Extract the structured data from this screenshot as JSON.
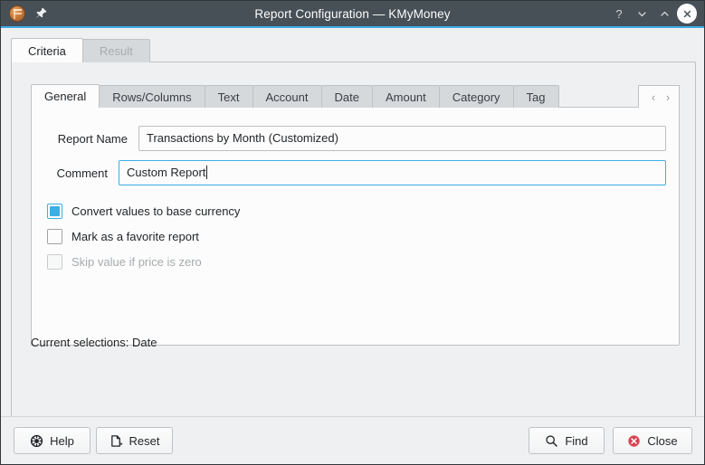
{
  "window": {
    "title": "Report Configuration — KMyMoney",
    "app_icon": "kmymoney-coin-icon",
    "pin_icon": "pin-icon",
    "controls": {
      "help": "?",
      "minimize": "minimize-icon",
      "maximize": "maximize-icon",
      "close": "close-icon"
    },
    "accent_color": "#3daee9",
    "titlebar_color": "#475057"
  },
  "outer_tabs": [
    {
      "label": "Criteria",
      "active": true,
      "disabled": false
    },
    {
      "label": "Result",
      "active": false,
      "disabled": true
    }
  ],
  "inner_tabs": [
    {
      "label": "General",
      "active": true
    },
    {
      "label": "Rows/Columns",
      "active": false
    },
    {
      "label": "Text",
      "active": false
    },
    {
      "label": "Account",
      "active": false
    },
    {
      "label": "Date",
      "active": false
    },
    {
      "label": "Amount",
      "active": false
    },
    {
      "label": "Category",
      "active": false
    },
    {
      "label": "Tag",
      "active": false
    }
  ],
  "tab_scroll": {
    "prev_icon": "chevron-left-icon",
    "prev_glyph": "‹",
    "next_icon": "chevron-right-icon",
    "next_glyph": "›"
  },
  "form": {
    "report_name": {
      "label": "Report Name",
      "value": "Transactions by Month (Customized)",
      "placeholder": "",
      "focused": false
    },
    "comment": {
      "label": "Comment",
      "value": "Custom Report",
      "placeholder": "",
      "focused": true
    },
    "checkboxes": [
      {
        "label": "Convert values to base currency",
        "checked": true,
        "disabled": false
      },
      {
        "label": "Mark as a favorite report",
        "checked": false,
        "disabled": false
      },
      {
        "label": "Skip value if price is zero",
        "checked": false,
        "disabled": true
      }
    ]
  },
  "status": {
    "current_selections": "Current selections: Date"
  },
  "buttons": {
    "help": {
      "label": "Help",
      "icon": "help-icon"
    },
    "reset": {
      "label": "Reset",
      "icon": "revert-icon"
    },
    "find": {
      "label": "Find",
      "icon": "search-icon"
    },
    "close": {
      "label": "Close",
      "icon": "close-circle-icon",
      "icon_color": "#da4453"
    }
  }
}
